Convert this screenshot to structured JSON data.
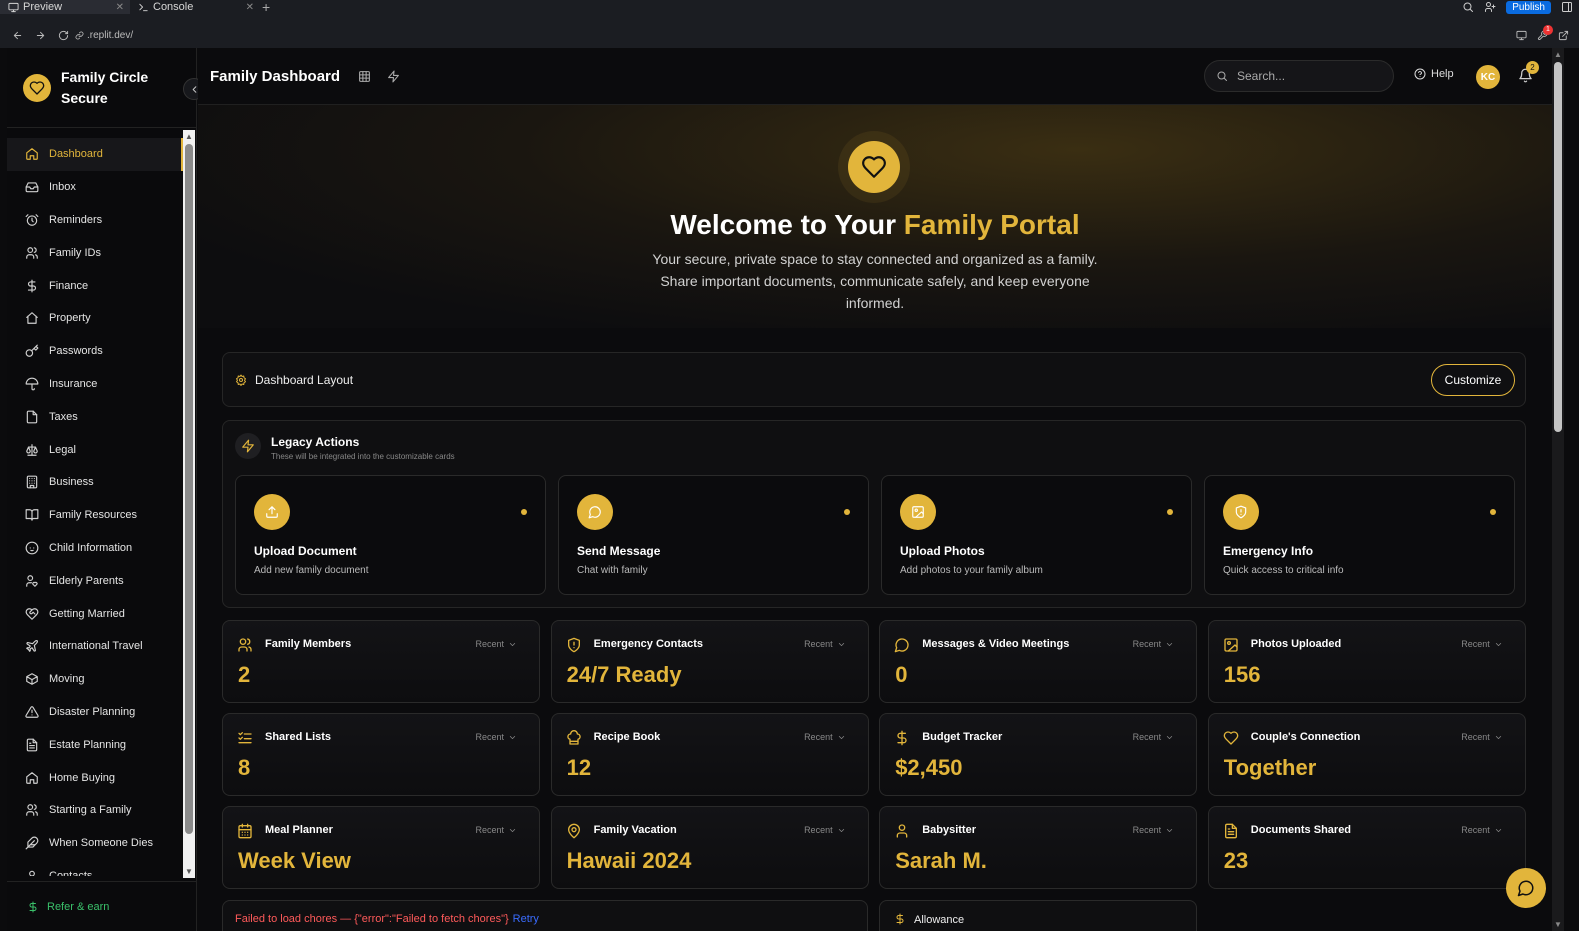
{
  "chrome": {
    "tabs": [
      {
        "label": "Preview",
        "active": true
      },
      {
        "label": "Console",
        "active": false
      }
    ],
    "url": ".replit.dev/",
    "publish_label": "Publish",
    "notif_count": "1"
  },
  "sidebar": {
    "brand": "Family Circle Secure",
    "items": [
      {
        "label": "Dashboard",
        "icon": "home-icon",
        "active": true
      },
      {
        "label": "Inbox",
        "icon": "inbox-icon"
      },
      {
        "label": "Reminders",
        "icon": "alarm-icon"
      },
      {
        "label": "Family IDs",
        "icon": "users-icon"
      },
      {
        "label": "Finance",
        "icon": "dollar-icon"
      },
      {
        "label": "Property",
        "icon": "house-icon"
      },
      {
        "label": "Passwords",
        "icon": "key-icon"
      },
      {
        "label": "Insurance",
        "icon": "umbrella-icon"
      },
      {
        "label": "Taxes",
        "icon": "file-icon"
      },
      {
        "label": "Legal",
        "icon": "scale-icon"
      },
      {
        "label": "Business",
        "icon": "building-icon"
      },
      {
        "label": "Family Resources",
        "icon": "book-icon"
      },
      {
        "label": "Child Information",
        "icon": "baby-icon"
      },
      {
        "label": "Elderly Parents",
        "icon": "user-heart-icon"
      },
      {
        "label": "Getting Married",
        "icon": "heart-handshake-icon"
      },
      {
        "label": "International Travel",
        "icon": "plane-icon"
      },
      {
        "label": "Moving",
        "icon": "package-icon"
      },
      {
        "label": "Disaster Planning",
        "icon": "alert-triangle-icon"
      },
      {
        "label": "Estate Planning",
        "icon": "document-icon"
      },
      {
        "label": "Home Buying",
        "icon": "home-icon"
      },
      {
        "label": "Starting a Family",
        "icon": "users-icon"
      },
      {
        "label": "When Someone Dies",
        "icon": "feather-icon"
      },
      {
        "label": "Contacts",
        "icon": "contact-icon"
      }
    ],
    "refer_label": "Refer & earn"
  },
  "topbar": {
    "title": "Family Dashboard",
    "search_placeholder": "Search...",
    "help_label": "Help",
    "avatar_initials": "KC",
    "notif_count": "2"
  },
  "hero": {
    "title_prefix": "Welcome to Your ",
    "title_highlight": "Family Portal",
    "subtitle": "Your secure, private space to stay connected and organized as a family. Share important documents, communicate safely, and keep everyone informed."
  },
  "layout_card": {
    "title": "Dashboard Layout",
    "customize_label": "Customize"
  },
  "legacy": {
    "title": "Legacy Actions",
    "subtitle": "These will be integrated into the customizable cards",
    "actions": [
      {
        "title": "Upload Document",
        "subtitle": "Add new family document",
        "icon": "upload-icon"
      },
      {
        "title": "Send Message",
        "subtitle": "Chat with family",
        "icon": "message-icon"
      },
      {
        "title": "Upload Photos",
        "subtitle": "Add photos to your family album",
        "icon": "image-icon"
      },
      {
        "title": "Emergency Info",
        "subtitle": "Quick access to critical info",
        "icon": "shield-icon"
      }
    ]
  },
  "stats": [
    {
      "label": "Family Members",
      "value": "2",
      "recent": "Recent",
      "icon": "users-icon"
    },
    {
      "label": "Emergency Contacts",
      "value": "24/7 Ready",
      "recent": "Recent",
      "icon": "shield-icon"
    },
    {
      "label": "Messages & Video Meetings",
      "value": "0",
      "recent": "Recent",
      "icon": "message-icon"
    },
    {
      "label": "Photos Uploaded",
      "value": "156",
      "recent": "Recent",
      "icon": "image-icon"
    },
    {
      "label": "Shared Lists",
      "value": "8",
      "recent": "Recent",
      "icon": "list-check-icon"
    },
    {
      "label": "Recipe Book",
      "value": "12",
      "recent": "Recent",
      "icon": "chef-hat-icon"
    },
    {
      "label": "Budget Tracker",
      "value": "$2,450",
      "recent": "Recent",
      "icon": "dollar-icon"
    },
    {
      "label": "Couple's Connection",
      "value": "Together",
      "recent": "Recent",
      "icon": "heart-icon"
    },
    {
      "label": "Meal Planner",
      "value": "Week View",
      "recent": "Recent",
      "icon": "calendar-icon"
    },
    {
      "label": "Family Vacation",
      "value": "Hawaii 2024",
      "recent": "Recent",
      "icon": "map-pin-icon"
    },
    {
      "label": "Babysitter",
      "value": "Sarah M.",
      "recent": "Recent",
      "icon": "user-icon"
    },
    {
      "label": "Documents Shared",
      "value": "23",
      "recent": "Recent",
      "icon": "document-icon"
    }
  ],
  "chores_error": {
    "message": "Failed to load chores — {\"error\":\"Failed to fetch chores\"}",
    "retry_label": "Retry"
  },
  "allowance": {
    "label": "Allowance"
  },
  "colors": {
    "accent": "#e2b53b",
    "background": "#0b0b0d",
    "error": "#ff5a5a",
    "link": "#3a6cff",
    "refer": "#3ac06a"
  }
}
